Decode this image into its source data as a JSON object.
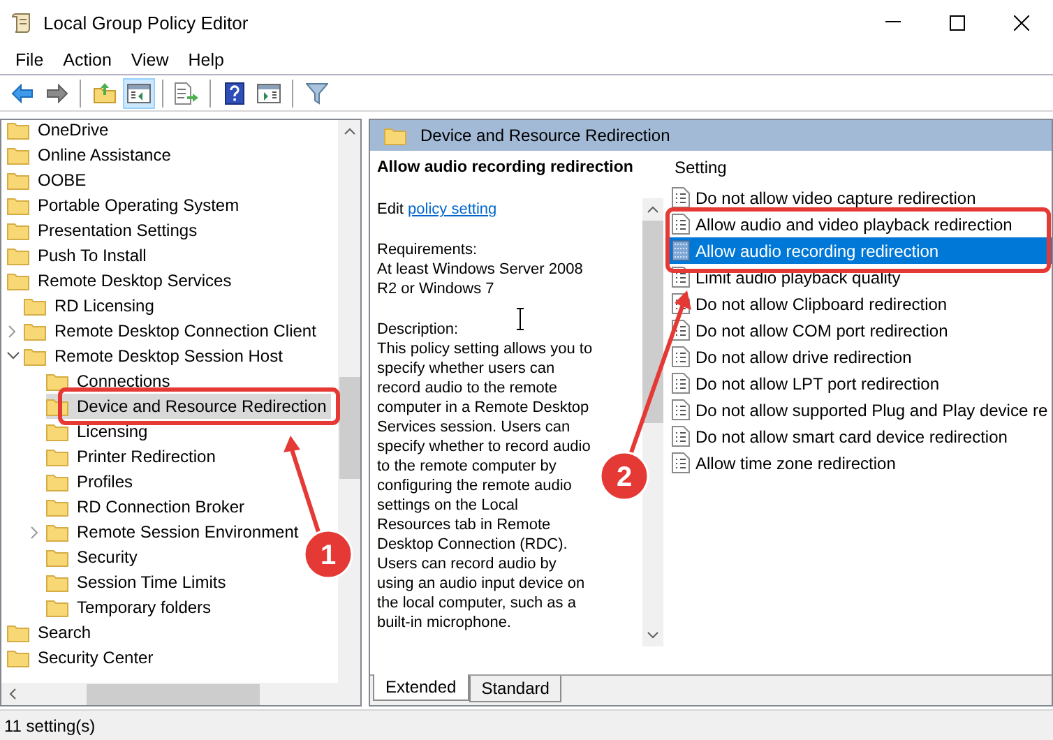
{
  "window": {
    "title": "Local Group Policy Editor"
  },
  "menu": [
    "File",
    "Action",
    "View",
    "Help"
  ],
  "toolbar_groups": [
    {
      "buttons": [
        {
          "kind": "back",
          "pressed": false
        },
        {
          "kind": "forward",
          "pressed": false
        }
      ]
    },
    {
      "buttons": [
        {
          "kind": "up",
          "pressed": false
        },
        {
          "kind": "tree",
          "pressed": true
        }
      ]
    },
    {
      "buttons": [
        {
          "kind": "export",
          "pressed": false
        }
      ]
    },
    {
      "buttons": [
        {
          "kind": "help",
          "pressed": false
        },
        {
          "kind": "pane",
          "pressed": false
        }
      ]
    },
    {
      "buttons": [
        {
          "kind": "filter",
          "pressed": false
        }
      ]
    }
  ],
  "tree": [
    {
      "label": "OneDrive",
      "selected": false
    },
    {
      "label": "Online Assistance",
      "selected": false
    },
    {
      "label": "OOBE",
      "selected": false
    },
    {
      "label": "Portable Operating System",
      "selected": false
    },
    {
      "label": "Presentation Settings",
      "selected": false
    },
    {
      "label": "Push To Install",
      "selected": false
    },
    {
      "label": "Remote Desktop Services",
      "selected": false,
      "children": [
        {
          "label": "RD Licensing",
          "selected": false
        },
        {
          "label": "Remote Desktop Connection Client",
          "selected": false,
          "expanded": false
        },
        {
          "label": "Remote Desktop Session Host",
          "selected": false,
          "expanded": true,
          "children": [
            {
              "label": "Connections",
              "selected": false
            },
            {
              "label": "Device and Resource Redirection",
              "selected": true
            },
            {
              "label": "Licensing",
              "selected": false
            },
            {
              "label": "Printer Redirection",
              "selected": false
            },
            {
              "label": "Profiles",
              "selected": false
            },
            {
              "label": "RD Connection Broker",
              "selected": false
            },
            {
              "label": "Remote Session Environment",
              "selected": false,
              "expanded": false
            },
            {
              "label": "Security",
              "selected": false
            },
            {
              "label": "Session Time Limits",
              "selected": false
            },
            {
              "label": "Temporary folders",
              "selected": false
            }
          ]
        }
      ]
    },
    {
      "label": "Search",
      "selected": false
    },
    {
      "label": "Security Center",
      "selected": false
    }
  ],
  "details": {
    "folder": "Device and Resource Redirection",
    "title": "Allow audio recording redirection",
    "edit_prefix": "Edit",
    "edit_link": "policy setting",
    "requirements_label": "Requirements:",
    "requirements": "At least Windows Server 2008 R2 or Windows 7",
    "description_label": "Description:",
    "description": "This policy setting allows you to specify whether users can record audio to the remote computer in a Remote Desktop Services session. Users can specify whether to record audio to the remote computer by configuring the remote audio settings on the Local Resources tab in Remote Desktop Connection (RDC). Users can record audio by using an audio input device on the local computer, such as a built-in microphone."
  },
  "settings": {
    "column": "Setting",
    "rows": [
      {
        "label": "Do not allow video capture redirection",
        "selected": false
      },
      {
        "label": "Allow audio and video playback redirection",
        "selected": false
      },
      {
        "label": "Allow audio recording redirection",
        "selected": true
      },
      {
        "label": "Limit audio playback quality",
        "selected": false
      },
      {
        "label": "Do not allow Clipboard redirection",
        "selected": false
      },
      {
        "label": "Do not allow COM port redirection",
        "selected": false
      },
      {
        "label": "Do not allow drive redirection",
        "selected": false
      },
      {
        "label": "Do not allow LPT port redirection",
        "selected": false
      },
      {
        "label": "Do not allow supported Plug and Play device re",
        "selected": false
      },
      {
        "label": "Do not allow smart card device redirection",
        "selected": false
      },
      {
        "label": "Allow time zone redirection",
        "selected": false
      }
    ]
  },
  "tabs": [
    {
      "label": "Extended",
      "selected": true
    },
    {
      "label": "Standard",
      "selected": false
    }
  ],
  "status_bar": "11 setting(s)",
  "annotations": [
    {
      "number": "1"
    },
    {
      "number": "2"
    }
  ]
}
